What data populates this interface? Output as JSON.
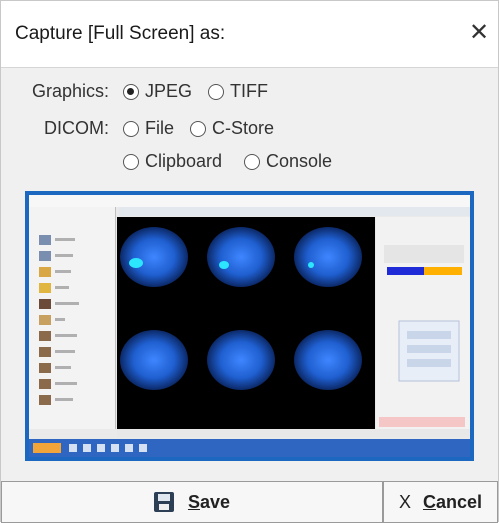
{
  "dialog": {
    "title": "Capture [Full Screen] as:",
    "close_glyph": "✕"
  },
  "graphics": {
    "label": "Graphics:",
    "options": [
      {
        "label": "JPEG",
        "selected": true
      },
      {
        "label": "TIFF",
        "selected": false
      }
    ]
  },
  "dicom": {
    "label": "DICOM:",
    "options": [
      {
        "label": "File",
        "selected": false
      },
      {
        "label": "C-Store",
        "selected": false
      },
      {
        "label": "Clipboard",
        "selected": false
      },
      {
        "label": "Console",
        "selected": false
      }
    ]
  },
  "buttons": {
    "save_first": "S",
    "save_rest": "ave",
    "cancel_first": "C",
    "cancel_rest": "ancel",
    "cancel_glyph": "X"
  },
  "icons": {
    "save": "floppy-disk-icon",
    "close": "close-icon",
    "cancel": "x-icon"
  },
  "colors": {
    "frame": "#1c67c0",
    "dark": "#000000",
    "brain": "#1f5fd0",
    "hotspot": "#2ce6ff",
    "taskbar": "#2e66c2"
  }
}
